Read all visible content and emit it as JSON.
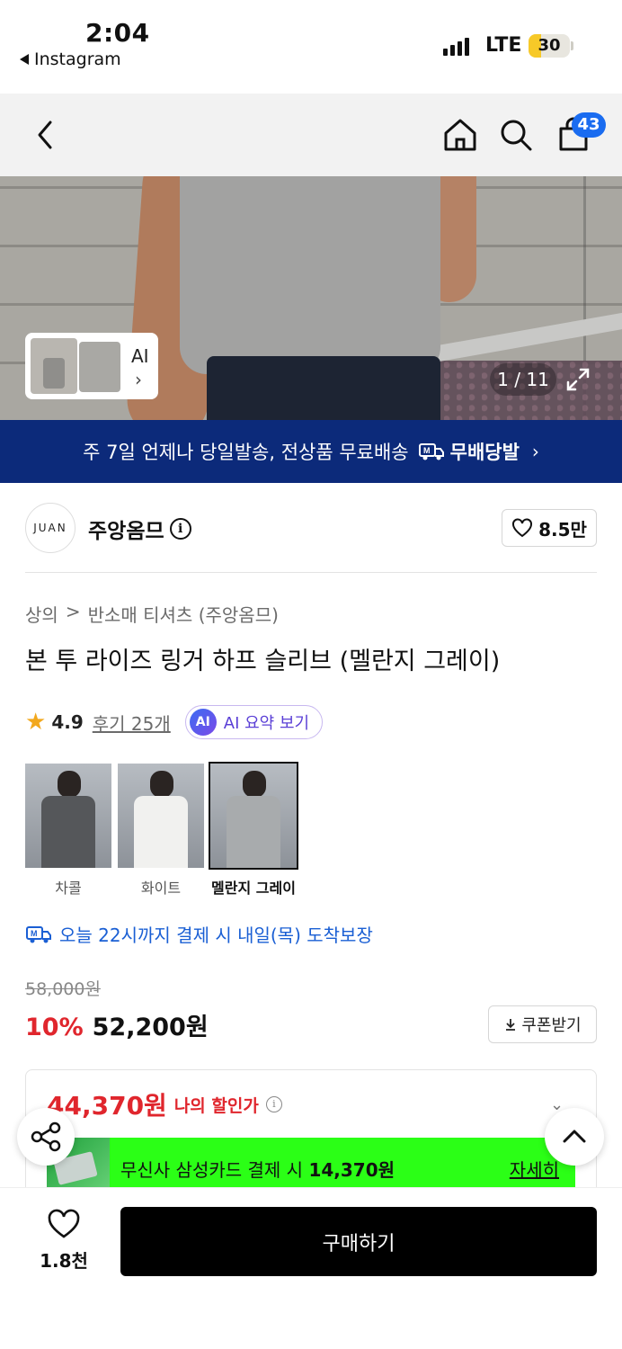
{
  "status_bar": {
    "time": "2:04",
    "back_app": "Instagram",
    "network": "LTE",
    "battery": "30",
    "battery_level": 0.3
  },
  "nav": {
    "cart_count": "43"
  },
  "gallery": {
    "ai_label": "AI",
    "counter": "1 / 11"
  },
  "shipping_banner": {
    "text": "주 7일 언제나 당일발송, 전상품 무료배송",
    "brand": "무배당발"
  },
  "seller": {
    "logo_text": "JUAN",
    "name": "주앙옴므",
    "likes": "8.5만"
  },
  "breadcrumb": {
    "level1": "상의",
    "separator": ">",
    "level2": "반소매 티셔츠 (주앙옴므)"
  },
  "product": {
    "title": "본 투 라이즈 링거 하프 슬리브 (멜란지 그레이)",
    "rating": "4.9",
    "reviews": "후기 25개",
    "ai_badge": "AI",
    "ai_summary": "AI 요약 보기"
  },
  "color_options": [
    {
      "label": "차콜",
      "color": "#55575a",
      "selected": false
    },
    {
      "label": "화이트",
      "color": "#f1f1ef",
      "selected": false
    },
    {
      "label": "멜란지 그레이",
      "color": "#a8abad",
      "selected": true
    }
  ],
  "delivery": {
    "text": "오늘 22시까지 결제 시 내일(목) 도착보장"
  },
  "price": {
    "original": "58,000원",
    "discount": "10%",
    "sale": "52,200원",
    "coupon_label": "쿠폰받기"
  },
  "my_price": {
    "amount": "44,370원",
    "label": "나의 할인가"
  },
  "card_promo": {
    "text_prefix": "무신사 삼성카드 결제 시 ",
    "text_amount": "14,370원",
    "more": "자세히"
  },
  "bottom_bar": {
    "wish_count": "1.8천",
    "buy_label": "구매하기"
  },
  "colors": {
    "brand_navy": "#0c2a7a",
    "badge_blue": "#1a6cf0",
    "sale_red": "#e0262d",
    "promo_green": "#2bff16",
    "delivery_blue": "#1a5fd4"
  }
}
